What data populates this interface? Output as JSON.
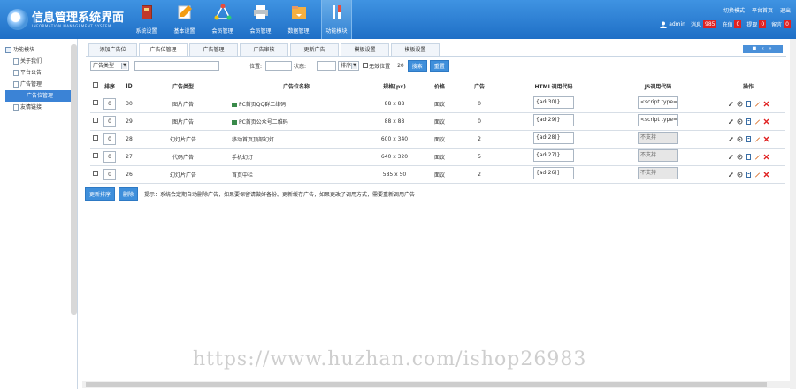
{
  "app": {
    "title": "信息管理系统界面",
    "subtitle": "INFORMATION MANAGEMENT SYSTEM",
    "accent_color": "#2f80d2"
  },
  "nav": [
    {
      "label": "系统设置",
      "icon": "book-icon",
      "active": false
    },
    {
      "label": "基本设置",
      "icon": "edit-icon",
      "active": false
    },
    {
      "label": "会员管理",
      "icon": "network-icon",
      "active": false
    },
    {
      "label": "会员管理",
      "icon": "printer-icon",
      "active": false
    },
    {
      "label": "数据管理",
      "icon": "download-folder-icon",
      "active": false
    },
    {
      "label": "功能模块",
      "icon": "tools-icon",
      "active": true
    }
  ],
  "top_links": [
    "切换模式",
    "平台首页",
    "退出"
  ],
  "status": {
    "user": "admin",
    "items": [
      {
        "label": "消息",
        "count": "985"
      },
      {
        "label": "充值",
        "count": "0"
      },
      {
        "label": "提现",
        "count": "0"
      },
      {
        "label": "留言",
        "count": "0"
      }
    ]
  },
  "sidebar": {
    "items": [
      {
        "label": "功能模块",
        "level": 0,
        "selected": false
      },
      {
        "label": "关于我们",
        "level": 1,
        "selected": false
      },
      {
        "label": "平台公告",
        "level": 1,
        "selected": false
      },
      {
        "label": "广告管理",
        "level": 1,
        "selected": false
      },
      {
        "label": "广告位管理",
        "level": 2,
        "selected": true
      },
      {
        "label": "友情链接",
        "level": 1,
        "selected": false
      }
    ]
  },
  "tabs": [
    {
      "label": "添加广告位",
      "active": false
    },
    {
      "label": "广告位管理",
      "active": true
    },
    {
      "label": "广告管理",
      "active": false
    },
    {
      "label": "广告审核",
      "active": false
    },
    {
      "label": "更新广告",
      "active": false
    },
    {
      "label": "模板设置",
      "active": false
    },
    {
      "label": "模板设置",
      "active": false
    }
  ],
  "tab_tools": "■ « »",
  "filter": {
    "type_value": "广告类型",
    "label_position": "位置:",
    "label_status": "状态:",
    "sort_value": "排序",
    "checkbox_label": "无效位置",
    "count": "20",
    "search_button": "搜索",
    "reset_button": "重置"
  },
  "table": {
    "headers": [
      "排序",
      "ID",
      "广告类型",
      "广告位名称",
      "规格(px)",
      "价格",
      "广告",
      "HTML调用代码",
      "JS调用代码",
      "操作"
    ],
    "rows": [
      {
        "sort": "0",
        "id": "30",
        "type": "图片广告",
        "name": "PC首页QQ群二维码",
        "size": "88 x 88",
        "price": "面议",
        "count": "0",
        "html": "{ad(30)}",
        "js": "<script type=\"",
        "js_supported": true,
        "has_icon": true
      },
      {
        "sort": "0",
        "id": "29",
        "type": "图片广告",
        "name": "PC首页公众号二维码",
        "size": "88 x 88",
        "price": "面议",
        "count": "0",
        "html": "{ad(29)}",
        "js": "<script type=\"",
        "js_supported": true,
        "has_icon": true
      },
      {
        "sort": "0",
        "id": "28",
        "type": "幻灯片广告",
        "name": "移动首页顶部幻灯",
        "size": "600 x 340",
        "price": "面议",
        "count": "2",
        "html": "{ad(28)}",
        "js": "不支持",
        "js_supported": false,
        "has_icon": false
      },
      {
        "sort": "0",
        "id": "27",
        "type": "代码广告",
        "name": "手机幻灯",
        "size": "640 x 320",
        "price": "面议",
        "count": "5",
        "html": "{ad(27)}",
        "js": "不支持",
        "js_supported": false,
        "has_icon": false
      },
      {
        "sort": "0",
        "id": "26",
        "type": "幻灯片广告",
        "name": "首页中栏",
        "size": "585 x 50",
        "price": "面议",
        "count": "2",
        "html": "{ad(26)}",
        "js": "不支持",
        "js_supported": false,
        "has_icon": false
      }
    ]
  },
  "bottom": {
    "update_button": "更新排序",
    "delete_button": "删除",
    "tip": "提示：系统会定期自动删除广告，如果要保留请做好备份。更新缓存广告，如果更改了调用方式，需要重新调用广告"
  },
  "watermark": "https://www.huzhan.com/ishop26983"
}
